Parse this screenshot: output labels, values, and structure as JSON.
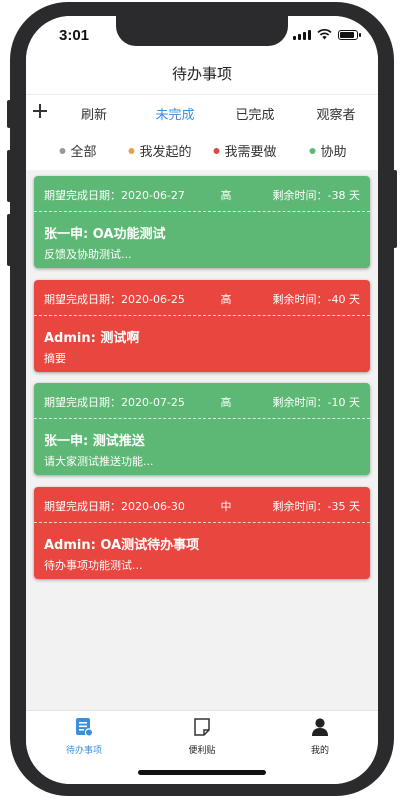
{
  "status_bar": {
    "time": "3:01"
  },
  "nav": {
    "title": "待办事项"
  },
  "tabs": [
    {
      "label": "刷新",
      "active": false
    },
    {
      "label": "未完成",
      "active": true
    },
    {
      "label": "已完成",
      "active": false
    },
    {
      "label": "观察者",
      "active": false
    }
  ],
  "filters": [
    {
      "label": "全部",
      "color": "#999999"
    },
    {
      "label": "我发起的",
      "color": "#e8a04f"
    },
    {
      "label": "我需要做",
      "color": "#d74b42"
    },
    {
      "label": "协助",
      "color": "#5cb874"
    }
  ],
  "colors": {
    "accent": "#3b8fd9",
    "card_green": "#5cb874",
    "card_red": "#e8463f"
  },
  "tasks": [
    {
      "date": "期望完成日期：2020-06-27",
      "priority": "高",
      "remaining": "剩余时间：-38 天",
      "title": "张一申: OA功能测试",
      "desc": "反馈及协助测试...",
      "color": "#5cb874"
    },
    {
      "date": "期望完成日期：2020-06-25",
      "priority": "高",
      "remaining": "剩余时间：-40 天",
      "title": "Admin: 测试啊",
      "desc": "摘要",
      "color": "#e8463f"
    },
    {
      "date": "期望完成日期：2020-07-25",
      "priority": "高",
      "remaining": "剩余时间：-10 天",
      "title": "张一申: 测试推送",
      "desc": "请大家测试推送功能...",
      "color": "#5cb874"
    },
    {
      "date": "期望完成日期：2020-06-30",
      "priority": "中",
      "remaining": "剩余时间：-35 天",
      "title": "Admin: OA测试待办事项",
      "desc": "待办事项功能测试...",
      "color": "#e8463f"
    }
  ],
  "tabbar": [
    {
      "label": "待办事项",
      "icon": "todo-list-icon",
      "active": true
    },
    {
      "label": "便利贴",
      "icon": "sticky-note-icon",
      "active": false
    },
    {
      "label": "我的",
      "icon": "user-icon",
      "active": false
    }
  ]
}
